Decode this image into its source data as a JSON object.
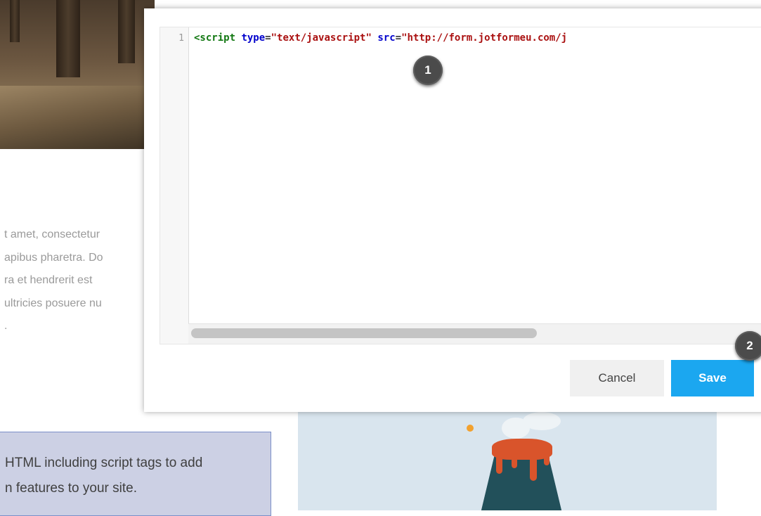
{
  "background_page": {
    "paragraph_lines": [
      "t amet, consectetur",
      " apibus pharetra. Do",
      "ra et hendrerit est",
      "ultricies posuere nu",
      "."
    ],
    "callout_lines": [
      "HTML including script tags to add",
      "n features to your site."
    ]
  },
  "editor": {
    "line_number": "1",
    "code": {
      "open_tag": "<script",
      "attr1": "type",
      "eq1": "=",
      "val1": "\"text/javascript\"",
      "attr2": "src",
      "eq2": "=",
      "val2": "\"http://form.jotformeu.com/j"
    }
  },
  "buttons": {
    "cancel_label": "Cancel",
    "save_label": "Save"
  },
  "markers": [
    "1",
    "2"
  ],
  "colors": {
    "save_button": "#1ba7f0",
    "cancel_button": "#f0f0f0",
    "marker": "#4b4b4b",
    "token_tag": "#117711",
    "token_attr": "#0000cc",
    "token_string": "#aa1111"
  }
}
